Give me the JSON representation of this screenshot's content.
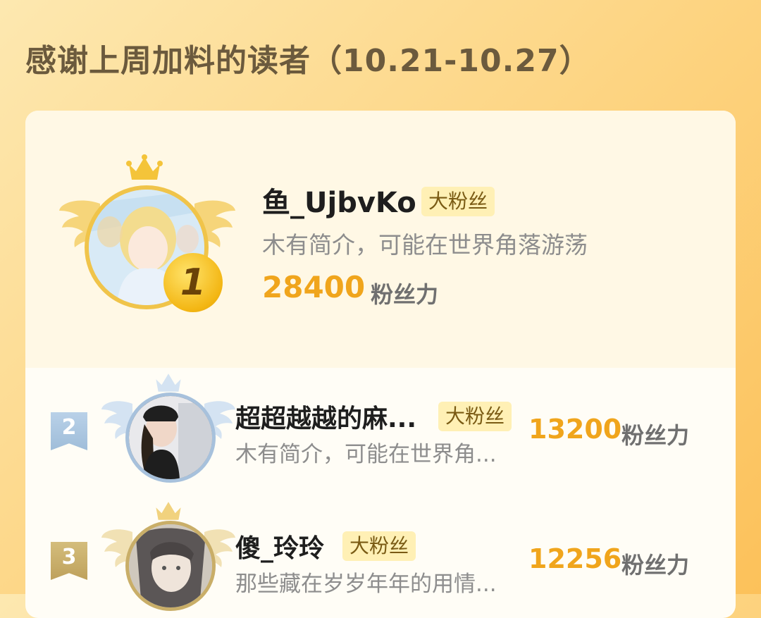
{
  "header": {
    "title": "感谢上周加料的读者（10.21-10.27）"
  },
  "colors": {
    "accent": "#f0a51c",
    "badge_bg": "#fff0b5",
    "silver": "#a9c4de",
    "bronze": "#c5ad6c"
  },
  "icons": {
    "crown": "crown-icon",
    "wing": "wing-icon"
  },
  "ranking": [
    {
      "rank": "1",
      "name": "鱼_UjbvKo",
      "badge": "大粉丝",
      "bio": "木有简介，可能在世界角落游荡",
      "score": "28400",
      "unit": "粉丝力"
    },
    {
      "rank": "2",
      "name": "超超越越的麻...",
      "badge": "大粉丝",
      "bio": "木有简介，可能在世界角...",
      "score": "13200",
      "unit": "粉丝力"
    },
    {
      "rank": "3",
      "name": "傻_玲玲",
      "badge": "大粉丝",
      "bio": "那些藏在岁岁年年的用情...",
      "score": "12256",
      "unit": "粉丝力"
    }
  ]
}
